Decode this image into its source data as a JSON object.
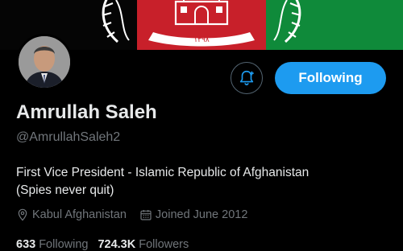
{
  "profile": {
    "display_name": "Amrullah Saleh",
    "handle": "@AmrullahSaleh2",
    "bio_line1": "First Vice President - Islamic Republic of Afghanistan",
    "bio_line2": "(Spies never quit)",
    "location": "Kabul Afghanistan",
    "joined": "Joined June 2012"
  },
  "actions": {
    "following_label": "Following",
    "notify_icon": "bell-plus-icon"
  },
  "stats": {
    "following_count": "633",
    "following_label": "Following",
    "followers_count": "724.3K",
    "followers_label": "Followers"
  },
  "banner": {
    "emblem_text": "۱۲۹۸",
    "colors": {
      "black": "#000000",
      "red": "#c8202a",
      "green": "#0f8a3a"
    }
  },
  "colors": {
    "accent": "#1d9bf0",
    "text_primary": "#e7e9ea",
    "text_secondary": "#71767b"
  }
}
